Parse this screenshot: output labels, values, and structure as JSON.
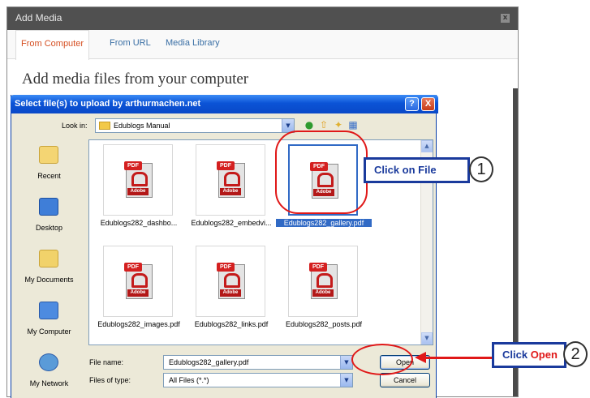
{
  "wp_modal": {
    "title": "Add Media",
    "close_label": "x",
    "tabs": [
      {
        "label": "From Computer",
        "active": true
      },
      {
        "label": "From URL",
        "active": false
      },
      {
        "label": "Media Library",
        "active": false
      }
    ],
    "heading": "Add media files from your computer"
  },
  "dialog": {
    "title": "Select file(s) to upload by arthurmachen.net",
    "help_label": "?",
    "close_label": "X",
    "look_in_label": "Look in:",
    "look_in_value": "Edublogs Manual",
    "places": [
      {
        "label": "Recent",
        "icon": "recent-folder-icon"
      },
      {
        "label": "Desktop",
        "icon": "desktop-icon"
      },
      {
        "label": "My Documents",
        "icon": "my-documents-icon"
      },
      {
        "label": "My Computer",
        "icon": "my-computer-icon"
      },
      {
        "label": "My Network",
        "icon": "my-network-icon"
      }
    ],
    "files": [
      {
        "name": "Edublogs282_dashbo...",
        "selected": false
      },
      {
        "name": "Edublogs282_embedvi...",
        "selected": false
      },
      {
        "name": "Edublogs282_gallery.pdf",
        "selected": true
      },
      {
        "name": "Edublogs282_images.pdf",
        "selected": false
      },
      {
        "name": "Edublogs282_links.pdf",
        "selected": false
      },
      {
        "name": "Edublogs282_posts.pdf",
        "selected": false
      }
    ],
    "pdf_badge": "PDF",
    "pdf_logo_text": "Adobe",
    "file_name_label": "File name:",
    "file_name_value": "Edublogs282_gallery.pdf",
    "file_type_label": "Files of type:",
    "file_type_value": "All Files (*.*)",
    "open_label": "Open",
    "cancel_label": "Cancel"
  },
  "annotations": {
    "step1_text": "Click on File",
    "step1_number": "1",
    "step2_text_a": "Click ",
    "step2_text_b": "Open",
    "step2_number": "2",
    "accent_red": "#e01818",
    "callout_blue": "#1a3a9c"
  }
}
